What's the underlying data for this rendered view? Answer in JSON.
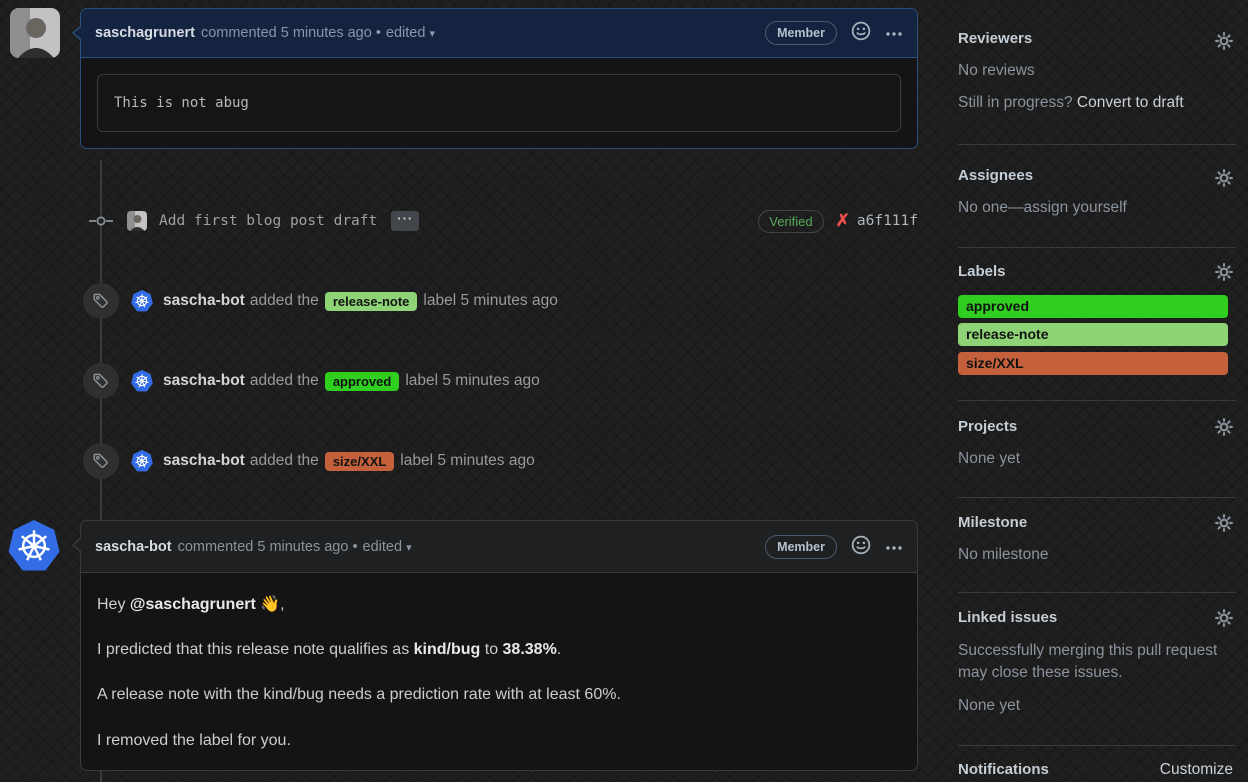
{
  "comment1": {
    "author": "saschagrunert",
    "meta": "commented 5 minutes ago •",
    "edited": "edited",
    "caret": "▾",
    "member_label": "Member",
    "body_code": "This is not abug"
  },
  "commit": {
    "message": "Add first blog post draft",
    "ellipsis": "···",
    "verified_label": "Verified",
    "x_mark": "✗",
    "sha": "a6f111f"
  },
  "events": [
    {
      "author": "sascha-bot",
      "action": "added the",
      "label": "release-note",
      "label_bg": "#8ed477",
      "suffix": "label 5 minutes ago"
    },
    {
      "author": "sascha-bot",
      "action": "added the",
      "label": "approved",
      "label_bg": "#2fce1f",
      "suffix": "label 5 minutes ago"
    },
    {
      "author": "sascha-bot",
      "action": "added the",
      "label": "size/XXL",
      "label_bg": "#c4613c",
      "suffix": "label 5 minutes ago"
    }
  ],
  "comment2": {
    "author": "sascha-bot",
    "meta": "commented 5 minutes ago •",
    "edited": "edited",
    "caret": "▾",
    "member_label": "Member",
    "p1_prefix": "Hey ",
    "p1_mention": "@saschagrunert",
    "p1_emoji": " 👋",
    "p1_suffix": ",",
    "p2_a": "I predicted that this release note qualifies as ",
    "p2_bold1": "kind/bug",
    "p2_b": " to ",
    "p2_bold2": "38.38%",
    "p2_c": ".",
    "p3": "A release note with the kind/bug needs a prediction rate with at least 60%.",
    "p4": "I removed the label for you."
  },
  "sidebar": {
    "reviewers": {
      "title": "Reviewers",
      "empty": "No reviews",
      "draft_prefix": "Still in progress? ",
      "draft_link": "Convert to draft"
    },
    "assignees": {
      "title": "Assignees",
      "empty_prefix": "No one—",
      "empty_link": "assign yourself"
    },
    "labels": {
      "title": "Labels",
      "items": [
        {
          "name": "approved",
          "bg": "#2fce1f"
        },
        {
          "name": "release-note",
          "bg": "#8ed477"
        },
        {
          "name": "size/XXL",
          "bg": "#c4613c"
        }
      ]
    },
    "projects": {
      "title": "Projects",
      "empty": "None yet"
    },
    "milestone": {
      "title": "Milestone",
      "empty": "No milestone"
    },
    "linked_issues": {
      "title": "Linked issues",
      "desc": "Successfully merging this pull request may close these issues.",
      "empty": "None yet"
    },
    "notifications": {
      "title": "Notifications",
      "customize": "Customize"
    }
  },
  "colors": {
    "accent_border": "#2d4f7c",
    "verified_green": "#57ab5a",
    "k8s_blue": "#326de6",
    "approved_green": "#2fce1f",
    "release_note_green": "#8ed477",
    "size_xxl_orange": "#c4613c"
  }
}
